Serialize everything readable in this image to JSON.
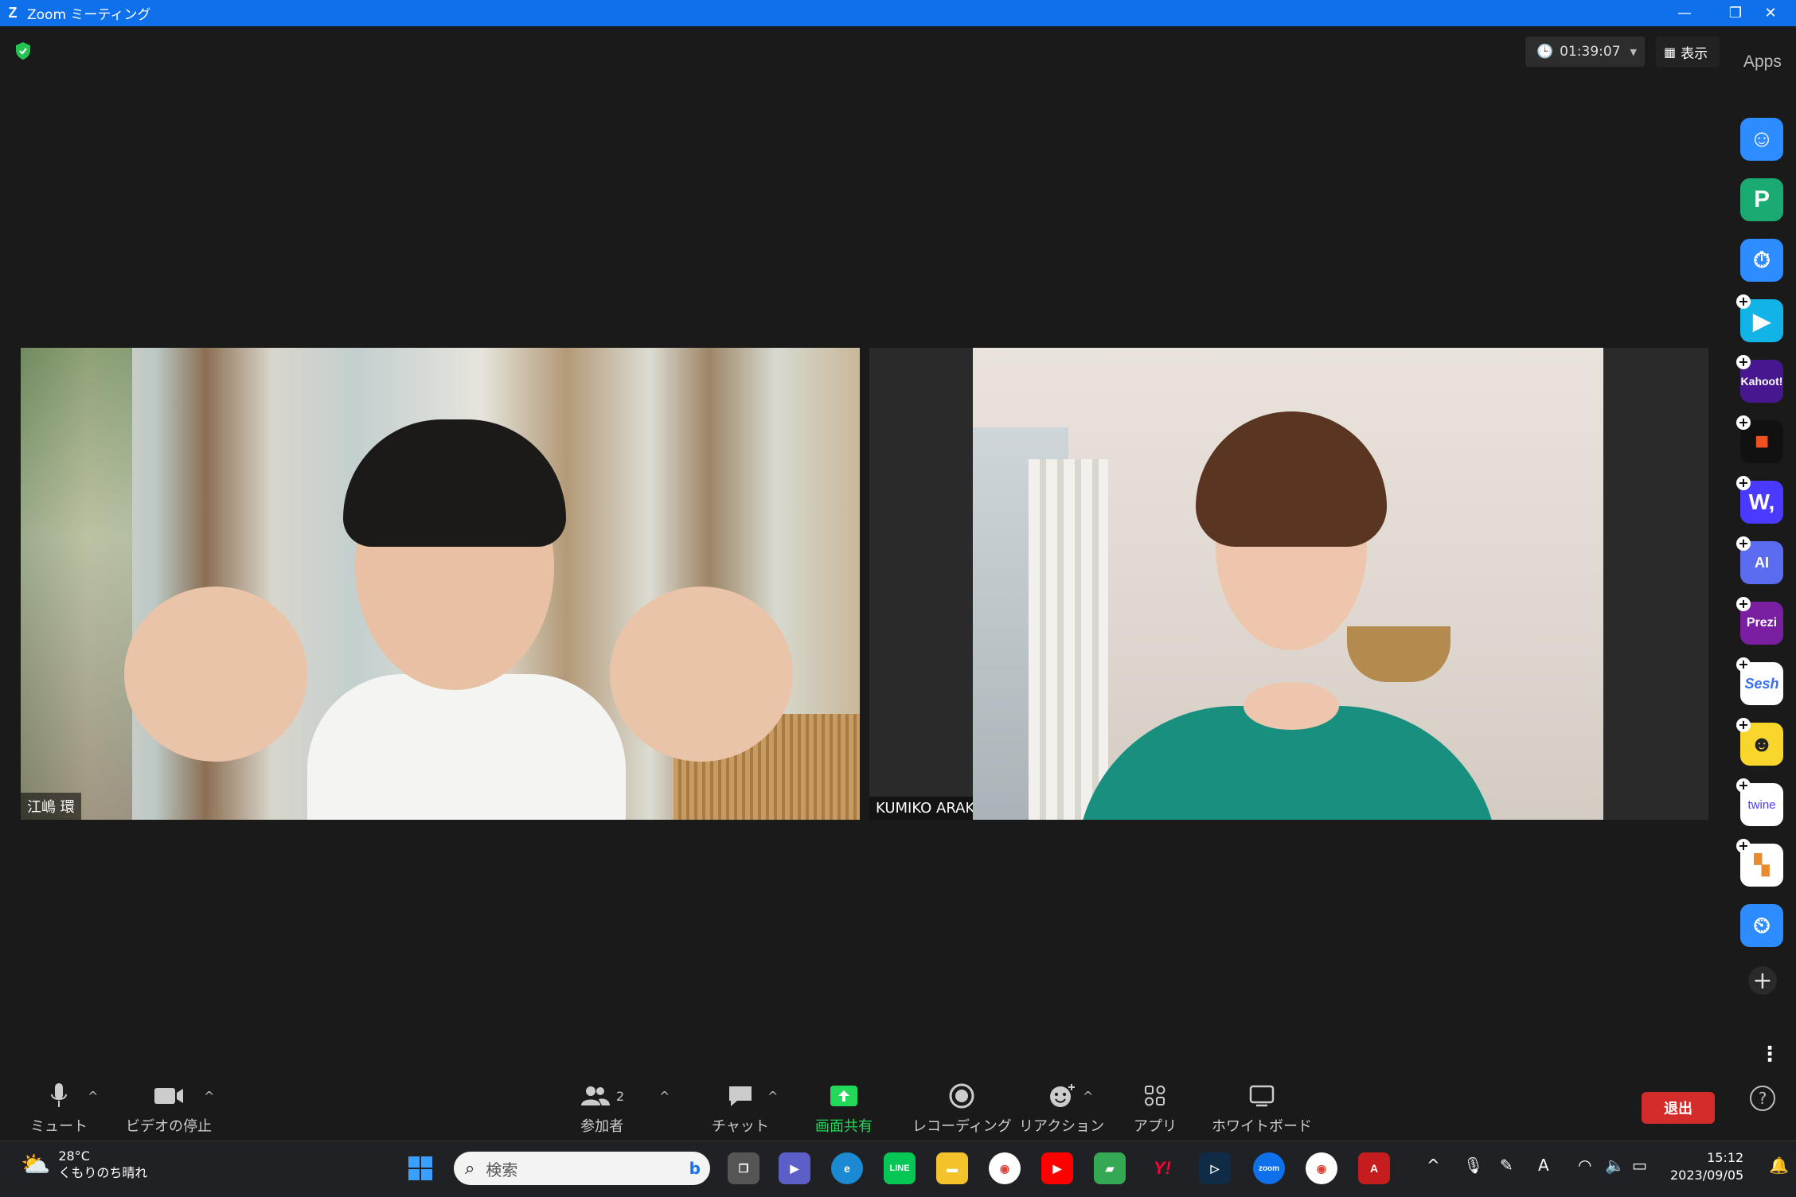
{
  "window": {
    "title": "Zoom ミーティング"
  },
  "meeting": {
    "timer": "01:39:07",
    "view_label": "表示",
    "participants": [
      {
        "name": "江嶋 環"
      },
      {
        "name": "KUMIKO ARAKAWA"
      }
    ]
  },
  "apps_panel": {
    "label": "Apps",
    "apps": [
      "smile-app",
      "p-app",
      "timer-app",
      "flip-app",
      "Kahoot!",
      "c-app",
      "W",
      "AI",
      "Prezi",
      "Sesh",
      "fun-app",
      "twine",
      "board-app",
      "stopwatch-app"
    ]
  },
  "toolbar": {
    "mute": "ミュート",
    "video": "ビデオの停止",
    "participants": "参加者",
    "participant_count": "2",
    "chat": "チャット",
    "share": "画面共有",
    "record": "レコーディング",
    "reactions": "リアクション",
    "apps": "アプリ",
    "whiteboard": "ホワイトボード",
    "leave": "退出"
  },
  "taskbar": {
    "weather_temp": "28°C",
    "weather_desc": "くもりのち晴れ",
    "search_placeholder": "検索",
    "time": "15:12",
    "date": "2023/09/05"
  },
  "colors": {
    "titlebar": "#0e71eb",
    "share_green": "#23d959",
    "leave_red": "#d42b2b"
  }
}
